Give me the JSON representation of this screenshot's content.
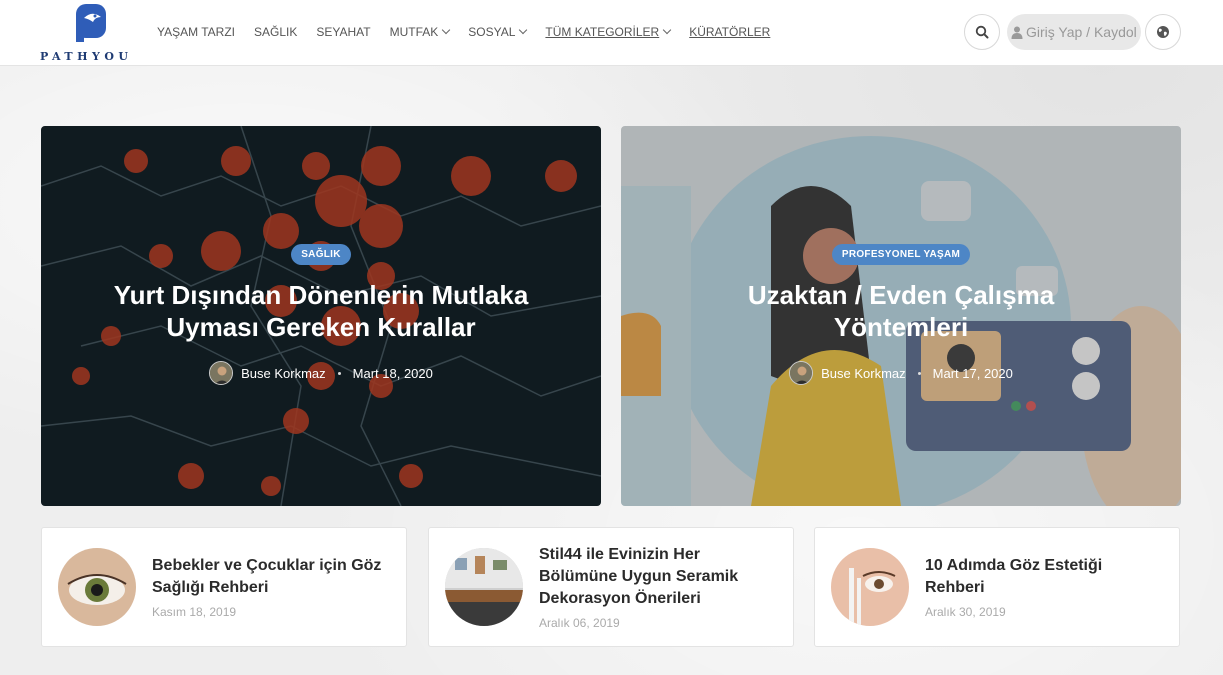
{
  "header": {
    "logo_text": "PATHYOU",
    "nav": [
      {
        "label": "YAŞAM TARZI",
        "dropdown": false,
        "underlined": false
      },
      {
        "label": "SAĞLIK",
        "dropdown": false,
        "underlined": false
      },
      {
        "label": "SEYAHAT",
        "dropdown": false,
        "underlined": false
      },
      {
        "label": "MUTFAK",
        "dropdown": true,
        "underlined": false
      },
      {
        "label": "SOSYAL",
        "dropdown": true,
        "underlined": false
      },
      {
        "label": "TÜM KATEGORİLER",
        "dropdown": true,
        "underlined": true
      },
      {
        "label": "KÜRATÖRLER",
        "dropdown": false,
        "underlined": true
      }
    ],
    "login_label": "Giriş Yap / Kaydol",
    "icons": {
      "search": "search-icon",
      "user": "user-icon",
      "globe": "globe-icon"
    }
  },
  "featured": [
    {
      "badge": "SAĞLIK",
      "title": "Yurt Dışından Dönenlerin Mutlaka Uyması Gereken Kurallar",
      "author": "Buse Korkmaz",
      "date": "Mart 18, 2020"
    },
    {
      "badge": "PROFESYONEL YAŞAM",
      "title": "Uzaktan / Evden Çalışma Yöntemleri",
      "author": "Buse Korkmaz",
      "date": "Mart 17, 2020"
    }
  ],
  "cards": [
    {
      "title": "Bebekler ve Çocuklar için Göz Sağlığı Rehberi",
      "date": "Kasım 18, 2019"
    },
    {
      "title": "Stil44 ile Evinizin Her Bölümüne Uygun Seramik Dekorasyon Önerileri",
      "date": "Aralık 06, 2019"
    },
    {
      "title": "10 Adımda Göz Estetiği Rehberi",
      "date": "Aralık 30, 2019"
    }
  ],
  "colors": {
    "badge": "#4d86c6",
    "brand": "#1f3b73"
  }
}
